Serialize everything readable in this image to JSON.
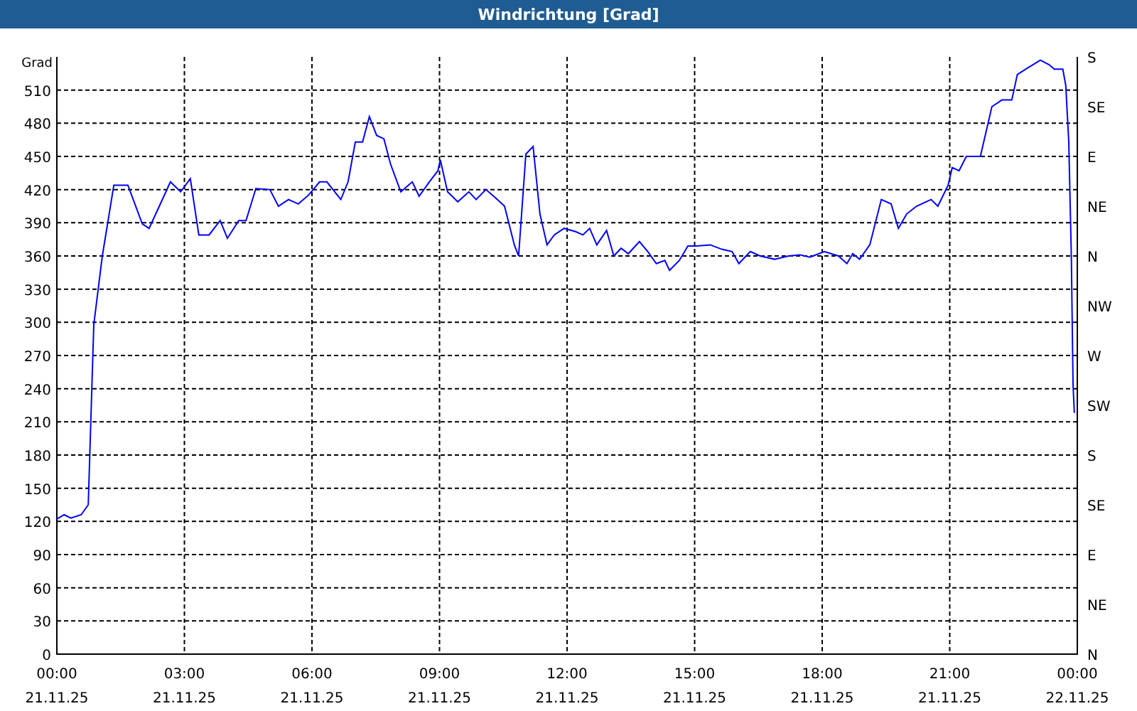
{
  "window": {
    "title": "Windrichtung [Grad]"
  },
  "chart_data": {
    "type": "line",
    "grid": true,
    "ylabel": "Grad",
    "ylim": [
      0,
      540
    ],
    "xlim": [
      0,
      24
    ],
    "yticks": [
      0,
      30,
      60,
      90,
      120,
      150,
      180,
      210,
      240,
      270,
      300,
      330,
      360,
      390,
      420,
      450,
      480,
      510
    ],
    "xticks": [
      {
        "value": 0,
        "label": "00:00"
      },
      {
        "value": 3,
        "label": "03:00"
      },
      {
        "value": 6,
        "label": "06:00"
      },
      {
        "value": 9,
        "label": "09:00"
      },
      {
        "value": 12,
        "label": "12:00"
      },
      {
        "value": 15,
        "label": "15:00"
      },
      {
        "value": 18,
        "label": "18:00"
      },
      {
        "value": 21,
        "label": "21:00"
      },
      {
        "value": 24,
        "label": "00:00"
      }
    ],
    "x": [
      0,
      0.17,
      0.33,
      0.57,
      0.74,
      0.87,
      1.07,
      1.34,
      1.67,
      2.01,
      2.17,
      2.41,
      2.67,
      2.91,
      3.14,
      3.34,
      3.58,
      3.84,
      4.01,
      4.28,
      4.45,
      4.68,
      5.01,
      5.21,
      5.45,
      5.68,
      5.92,
      6.18,
      6.35,
      6.68,
      6.85,
      7.02,
      7.19,
      7.35,
      7.52,
      7.69,
      7.85,
      8.09,
      8.36,
      8.52,
      8.76,
      8.96,
      9.02,
      9.19,
      9.43,
      9.69,
      9.86,
      10.09,
      10.36,
      10.53,
      10.76,
      10.86,
      11.03,
      11.2,
      11.36,
      11.53,
      11.7,
      11.93,
      12.2,
      12.37,
      12.53,
      12.7,
      12.93,
      13.1,
      13.27,
      13.44,
      13.7,
      13.9,
      14.1,
      14.3,
      14.41,
      14.64,
      14.84,
      15.04,
      15.37,
      15.64,
      15.88,
      16.04,
      16.31,
      16.54,
      16.88,
      17.21,
      17.48,
      17.71,
      18.05,
      18.38,
      18.58,
      18.72,
      18.88,
      19.12,
      19.39,
      19.62,
      19.79,
      19.99,
      20.22,
      20.56,
      20.72,
      20.96,
      21.06,
      21.22,
      21.39,
      21.72,
      21.99,
      22.23,
      22.46,
      22.59,
      22.79,
      23.13,
      23.33,
      23.46,
      23.66,
      23.73,
      23.8,
      23.86,
      23.9,
      23.93
    ],
    "series": [
      {
        "color": "#0000ff",
        "values": [
          122,
          126,
          123,
          126,
          135,
          298,
          360,
          424,
          424,
          389,
          385,
          405,
          427,
          418,
          430,
          379,
          379,
          392,
          376,
          392,
          392,
          421,
          420,
          405,
          411,
          407,
          415,
          427,
          427,
          411,
          427,
          463,
          463,
          486,
          469,
          466,
          443,
          418,
          427,
          414,
          427,
          437,
          447,
          418,
          409,
          418,
          411,
          420,
          411,
          405,
          370,
          360,
          452,
          459,
          398,
          370,
          379,
          385,
          382,
          379,
          385,
          370,
          383,
          360,
          367,
          362,
          373,
          364,
          353,
          356,
          347,
          356,
          369,
          369,
          370,
          366,
          364,
          353,
          364,
          360,
          357,
          360,
          361,
          359,
          364,
          360,
          353,
          362,
          357,
          370,
          411,
          407,
          385,
          398,
          405,
          411,
          405,
          424,
          440,
          437,
          450,
          450,
          495,
          501,
          501,
          524,
          529,
          537,
          533,
          529,
          529,
          514,
          463,
          360,
          244,
          218
        ]
      }
    ]
  },
  "date_labels": [
    "21.11.25",
    "21.11.25",
    "21.11.25",
    "21.11.25",
    "21.11.25",
    "21.11.25",
    "21.11.25",
    "21.11.25",
    "22.11.25"
  ],
  "compass_axis": [
    "S",
    "SE",
    "E",
    "NE",
    "N",
    "NW",
    "W",
    "SW",
    "S",
    "SE",
    "E",
    "NE",
    "N"
  ]
}
